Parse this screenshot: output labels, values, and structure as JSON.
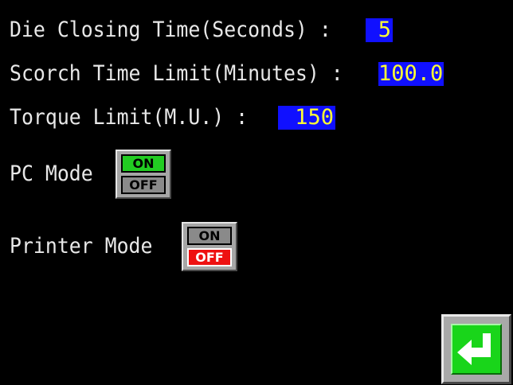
{
  "settings": {
    "die_closing": {
      "label": "Die Closing Time(Seconds) :",
      "value": "5"
    },
    "scorch_limit": {
      "label": "Scorch Time Limit(Minutes) :",
      "value": "100.0"
    },
    "torque_limit": {
      "label": "Torque Limit(M.U.) :",
      "value": "150"
    }
  },
  "modes": {
    "pc": {
      "label": "PC Mode",
      "on": "ON",
      "off": "OFF",
      "state": "ON"
    },
    "printer": {
      "label": "Printer Mode",
      "on": "ON",
      "off": "OFF",
      "state": "OFF"
    }
  },
  "colors": {
    "background": "#000000",
    "text": "#e8e8e8",
    "value_background": "#1010ff",
    "value_text": "#ffff33",
    "active_on": "#22cc22",
    "active_off": "#ee1111",
    "inactive": "#8a8a8a",
    "enter_button": "#19d51a"
  },
  "icons": {
    "enter": "enter-return-arrow-icon"
  }
}
